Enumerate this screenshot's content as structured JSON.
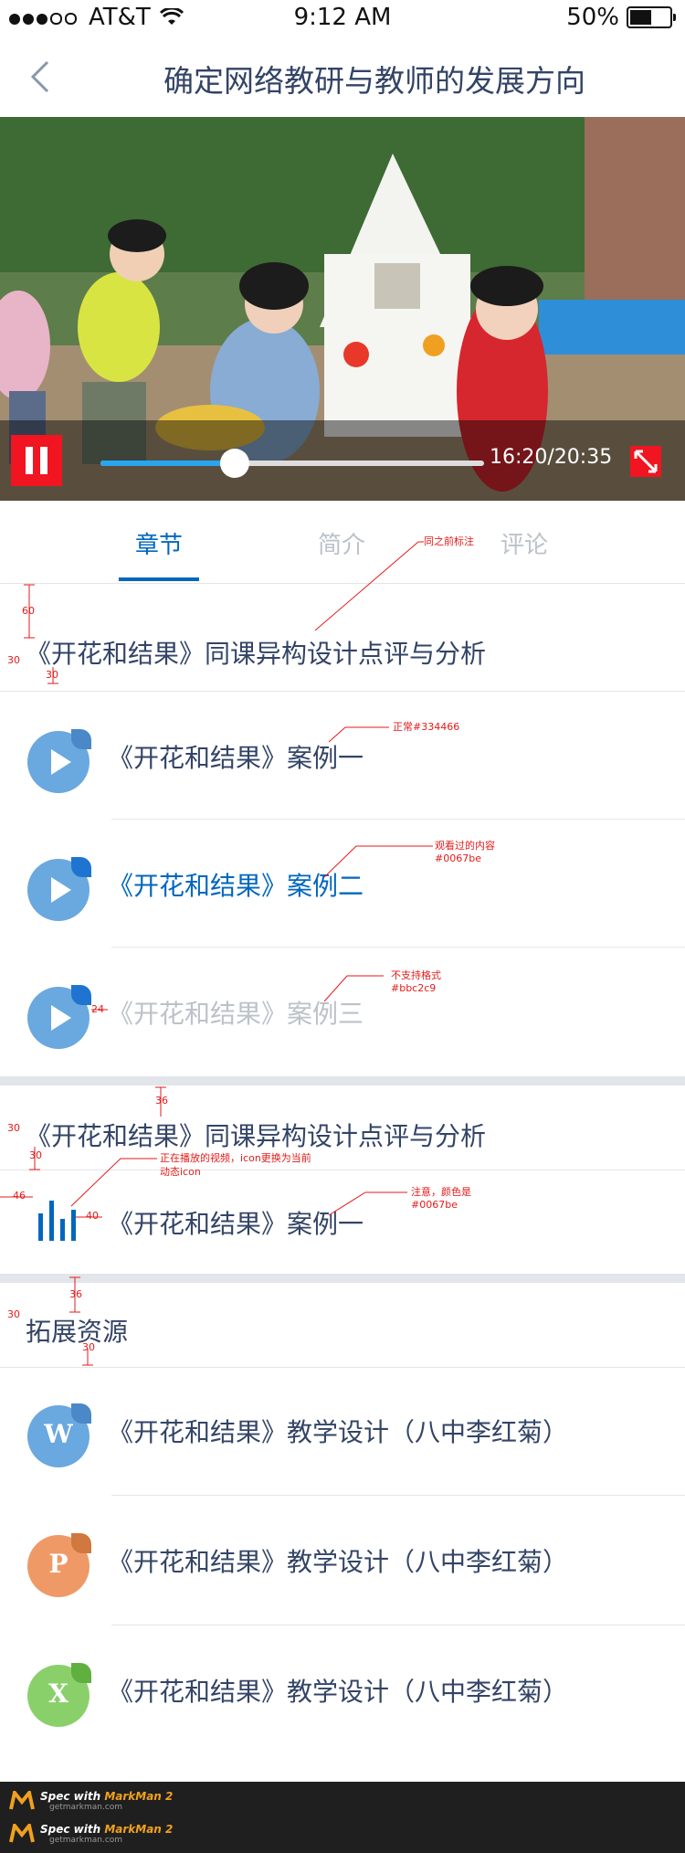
{
  "status_bar": {
    "carrier": "AT&T",
    "time": "9:12 AM",
    "battery": "50%"
  },
  "nav": {
    "title": "确定网络教研与教师的发展方向"
  },
  "video": {
    "time": "16:20/20:35",
    "progress": 0.35
  },
  "tabs": [
    {
      "label": "章节",
      "active": true
    },
    {
      "label": "简介",
      "active": false
    },
    {
      "label": "评论",
      "active": false
    }
  ],
  "sections": [
    {
      "title": "《开花和结果》同课异构设计点评与分析",
      "items": [
        {
          "label": "《开花和结果》案例一",
          "state": "normal",
          "color": "#334466"
        },
        {
          "label": "《开花和结果》案例二",
          "state": "watched",
          "color": "#0067be"
        },
        {
          "label": "《开花和结果》案例三",
          "state": "unsupported",
          "color": "#bbc2c9"
        }
      ]
    },
    {
      "title": "《开花和结果》同课异构设计点评与分析",
      "items": [
        {
          "label": "《开花和结果》案例一",
          "state": "playing",
          "color": "#334466"
        }
      ]
    }
  ],
  "resources": {
    "title": "拓展资源",
    "items": [
      {
        "letter": "W",
        "color": "#6aa8e0",
        "label": "《开花和结果》教学设计（八中李红菊）"
      },
      {
        "letter": "P",
        "color": "#ef9a66",
        "label": "《开花和结果》教学设计（八中李红菊）"
      },
      {
        "letter": "X",
        "color": "#8ad06a",
        "label": "《开花和结果》教学设计（八中李红菊）"
      }
    ]
  },
  "annotations": {
    "same_as_before": "同之前标注",
    "normal": "正常#334466",
    "watched": "观看过的内容",
    "watched_color": "#0067be",
    "unsupported": "不支持格式",
    "unsupported_color": "#bbc2c9",
    "playing_1": "正在播放的视频，icon更换为当前",
    "playing_2": "动态icon",
    "note": "注意，颜色是",
    "note_color": "#0067be"
  },
  "dimensions": {
    "d60": "60",
    "d30": "30",
    "d36": "36",
    "d24": "24",
    "d46": "46",
    "d40": "40"
  },
  "footer": {
    "brand_prefix": "Spec with ",
    "brand": "MarkMan 2",
    "site": "getmarkman.com"
  },
  "colors": {
    "primary": "#0067be",
    "text": "#334466",
    "disabled": "#bbc2c9",
    "accent_red": "#f01520"
  }
}
